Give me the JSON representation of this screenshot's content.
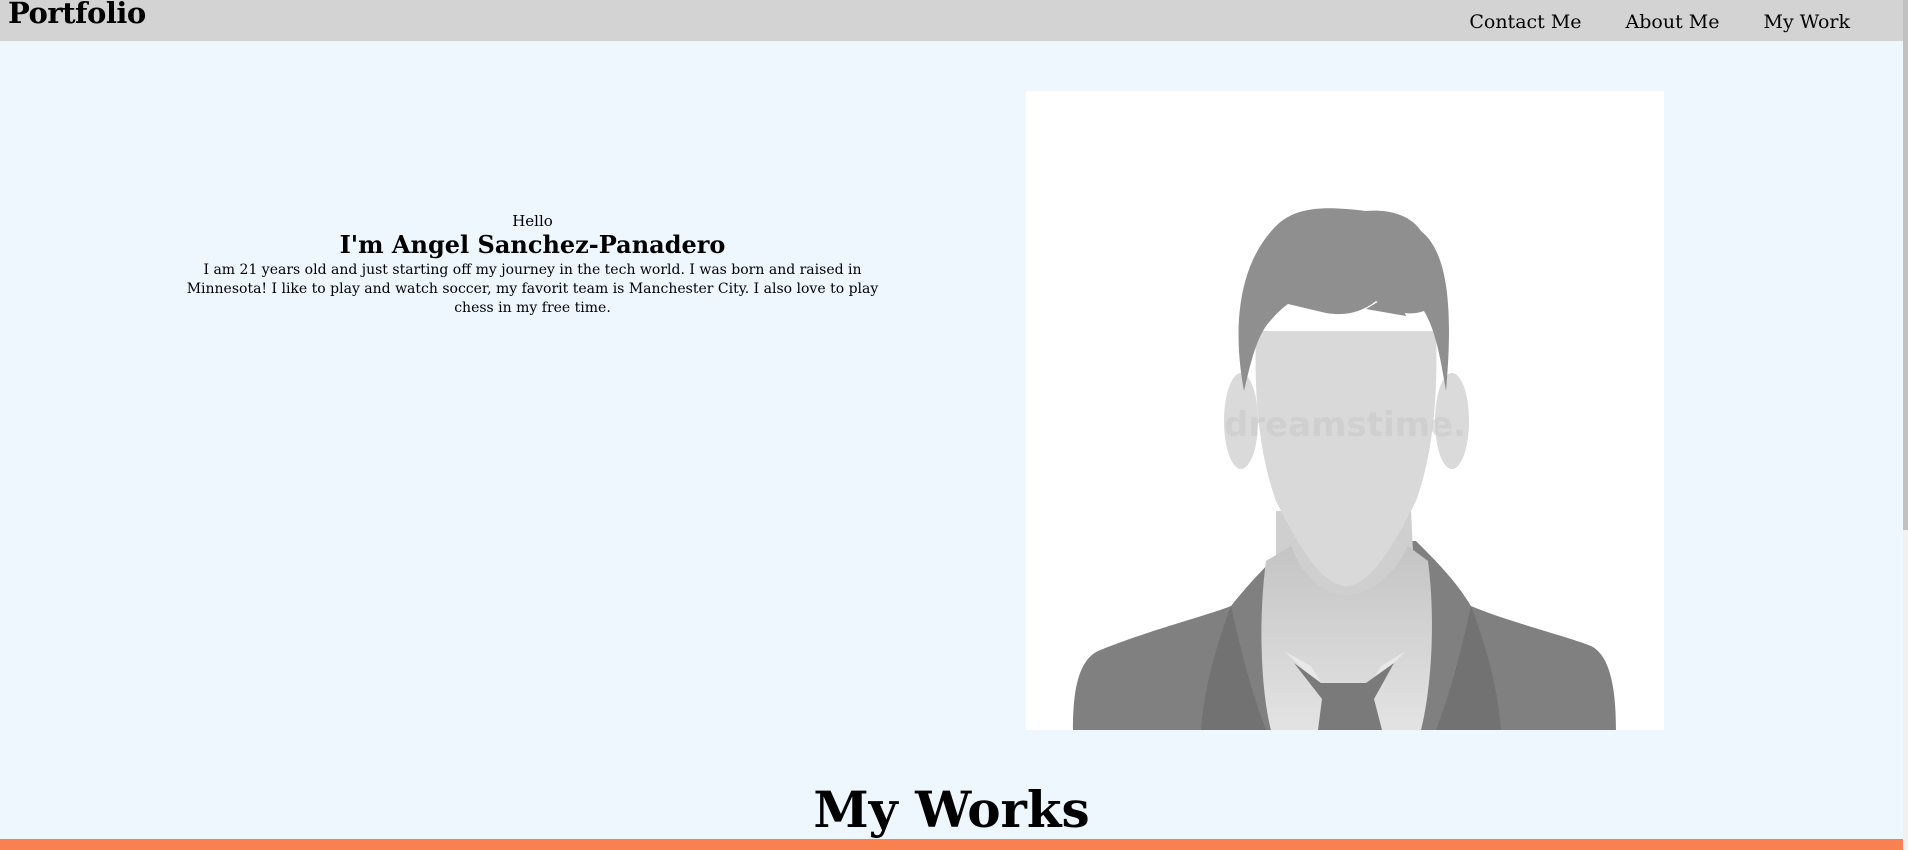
{
  "header": {
    "brand": "Portfolio",
    "nav": [
      {
        "label": "Contact Me"
      },
      {
        "label": "About Me"
      },
      {
        "label": "My Work"
      }
    ]
  },
  "intro": {
    "greeting": "Hello",
    "name": "I'm Angel Sanchez-Panadero",
    "bio": "I am 21 years old and just starting off my journey in the tech world. I was born and raised in Minnesota! I like to play and watch soccer, my favorit team is Manchester City. I also love to play chess in my free time."
  },
  "photo": {
    "icon": "default-avatar-icon",
    "watermark": "dreamstime."
  },
  "works": {
    "title": "My Works"
  },
  "colors": {
    "page_bg": "#eef7fe",
    "nav_bg": "#d3d3d3",
    "accent": "#f98150"
  }
}
